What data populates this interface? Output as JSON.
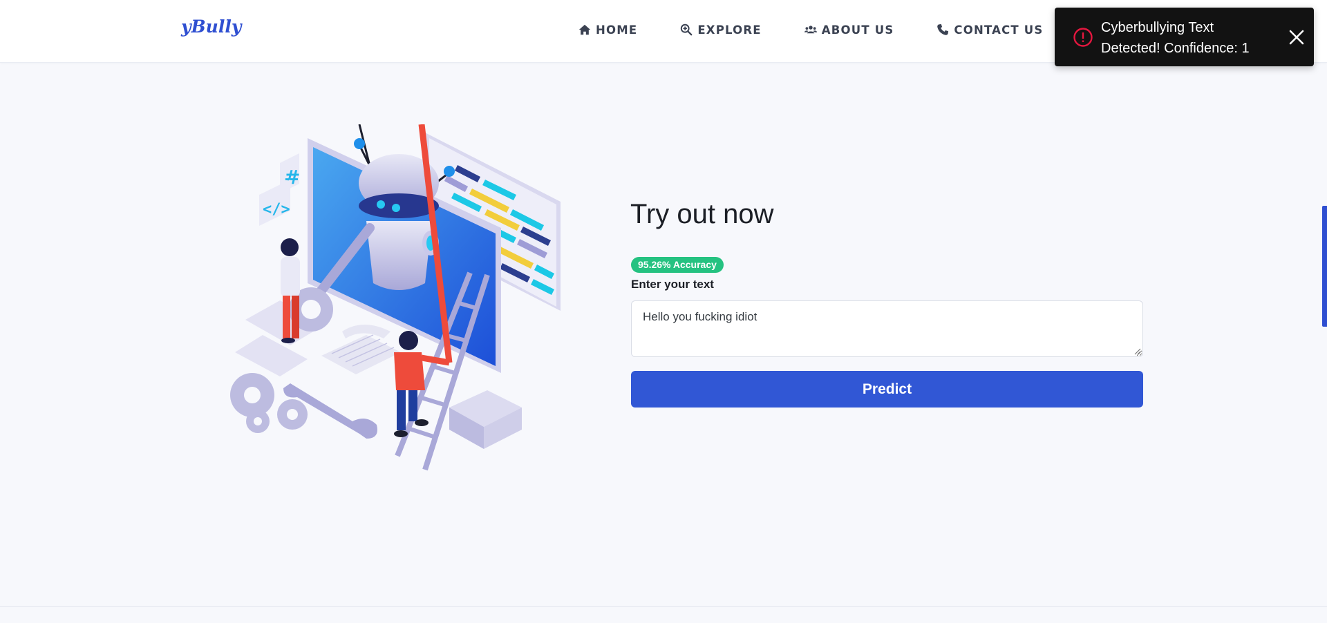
{
  "brand": {
    "name": "yBully",
    "color": "#2f4fd1"
  },
  "nav": {
    "items": [
      {
        "label": "HOME",
        "icon": "home-icon"
      },
      {
        "label": "EXPLORE",
        "icon": "search-plus-icon"
      },
      {
        "label": "ABOUT US",
        "icon": "users-icon"
      },
      {
        "label": "CONTACT US",
        "icon": "phone-icon"
      }
    ]
  },
  "toast": {
    "message": "Cyberbullying Text Detected! Confidence: 1",
    "icon": "error-circle-icon",
    "close_icon": "close-icon",
    "icon_color": "#e5173f"
  },
  "main": {
    "heading": "Try out now",
    "badge": "95.26% Accuracy",
    "badge_color": "#25c281",
    "input_label": "Enter your text",
    "input_value": "Hello you fucking idiot",
    "button_label": "Predict",
    "button_color": "#3157d5"
  },
  "illustration": {
    "icon": "robot-development-illustration"
  }
}
